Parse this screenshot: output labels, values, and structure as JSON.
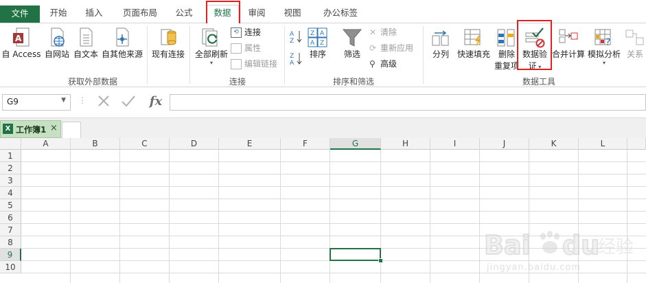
{
  "tabs": [
    {
      "label": "文件"
    },
    {
      "label": "开始"
    },
    {
      "label": "插入"
    },
    {
      "label": "页面布局"
    },
    {
      "label": "公式"
    },
    {
      "label": "数据"
    },
    {
      "label": "审阅"
    },
    {
      "label": "视图"
    },
    {
      "label": "办公标签"
    }
  ],
  "ribbon": {
    "get_external": {
      "label": "获取外部数据",
      "buttons": [
        {
          "label": "自 Access",
          "icon": "access-icon"
        },
        {
          "label": "自网站",
          "icon": "web-icon"
        },
        {
          "label": "自文本",
          "icon": "text-file-icon"
        },
        {
          "label": "自其他来源",
          "icon": "other-sources-icon"
        },
        {
          "label": "现有连接",
          "icon": "existing-connections-icon"
        }
      ]
    },
    "connections": {
      "label": "连接",
      "refresh_all": "全部刷新",
      "small": [
        {
          "label": "连接",
          "disabled": false
        },
        {
          "label": "属性",
          "disabled": true
        },
        {
          "label": "编辑链接",
          "disabled": true
        }
      ]
    },
    "sort_filter": {
      "label": "排序和筛选",
      "sort": "排序",
      "filter": "筛选",
      "small": [
        {
          "label": "清除",
          "disabled": true
        },
        {
          "label": "重新应用",
          "disabled": true
        },
        {
          "label": "高级",
          "disabled": false
        }
      ]
    },
    "data_tools": {
      "label": "数据工具",
      "buttons": [
        {
          "label": "分列"
        },
        {
          "label": "快速填充"
        },
        {
          "label": "删除",
          "label2": "重复项"
        },
        {
          "label": "数据验",
          "label2": "证"
        },
        {
          "label": "合并计算"
        },
        {
          "label": "模拟分析"
        },
        {
          "label": "关系"
        }
      ]
    }
  },
  "formula_bar": {
    "name_box": "G9",
    "fx": "fx",
    "value": ""
  },
  "workbook_tab": {
    "label": "工作簿1",
    "close": "×"
  },
  "grid": {
    "columns": [
      "A",
      "B",
      "C",
      "D",
      "E",
      "F",
      "G",
      "H",
      "I",
      "J",
      "K",
      "L"
    ],
    "rows": [
      "1",
      "2",
      "3",
      "4",
      "5",
      "6",
      "7",
      "8",
      "9",
      "10"
    ],
    "selected_cell": "G9"
  },
  "colors": {
    "accent": "#217346",
    "highlight_box": "#e32020"
  },
  "watermark": {
    "brand": "Baidu 经验",
    "url": "jingyan.baidu.com"
  }
}
